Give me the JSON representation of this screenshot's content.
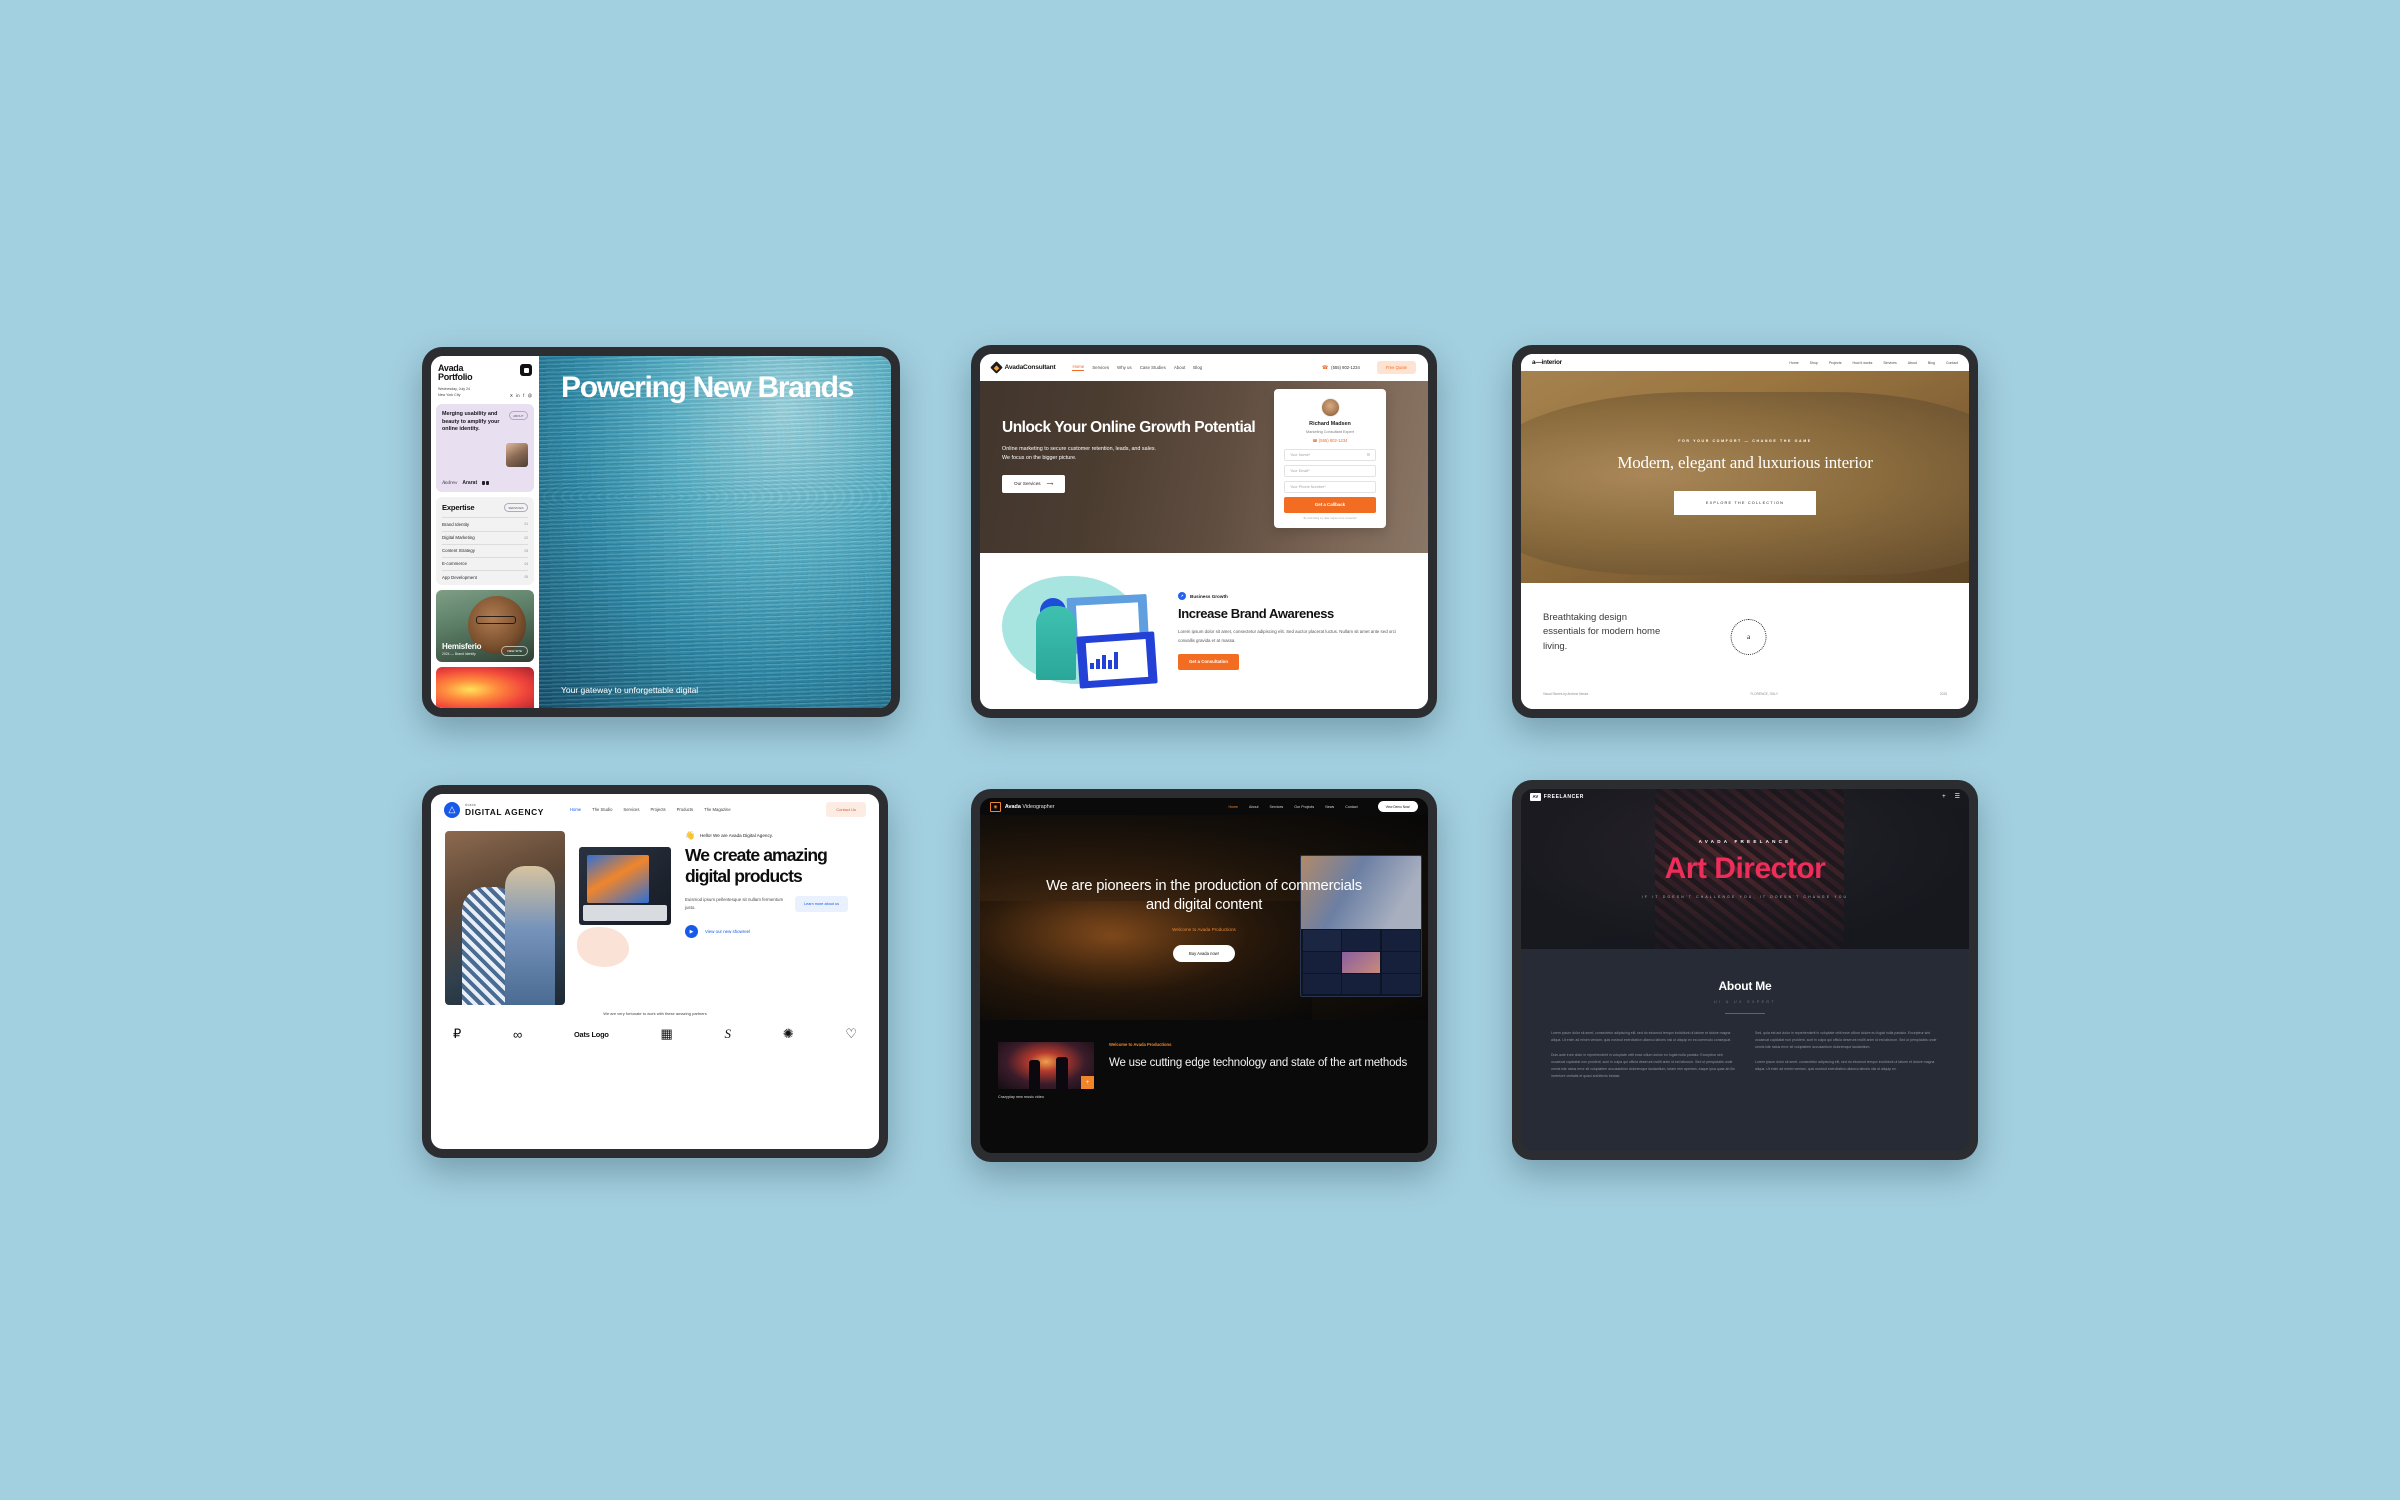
{
  "page": {
    "background_color": "#a3d0e0"
  },
  "cards": {
    "portfolio": {
      "logo_line1": "Avada",
      "logo_line2": "Portfolio",
      "date": "Wednesday, July 24",
      "location": "New York City",
      "socials": [
        "X",
        "in",
        "f",
        "@"
      ],
      "promo_text": "Merging usability and beauty to amplify your online identity.",
      "promo_pill": "ABOUT",
      "signature": "Andrew",
      "brand": "Ararat",
      "expertise_title": "Expertise",
      "expertise_pill": "SERVICES",
      "expertise": [
        {
          "label": "Brand Identity",
          "num": "01"
        },
        {
          "label": "Digital Marketing",
          "num": "02"
        },
        {
          "label": "Content Strategy",
          "num": "03"
        },
        {
          "label": "E-commerce",
          "num": "04"
        },
        {
          "label": "App Development",
          "num": "05"
        }
      ],
      "project_name": "Hemisferio",
      "project_meta": "2024 — Brand Identity",
      "project_button": "VIEW SITE",
      "hero_title": "Powering New Brands",
      "hero_sub": "Your gateway to unforgettable digital"
    },
    "consultant": {
      "logo": "AvadaConsultant",
      "menu": [
        "Home",
        "Services",
        "Why us",
        "Case Studies",
        "About",
        "Blog"
      ],
      "phone": "(555) 802-1234",
      "quote_button": "Free Quote",
      "hero_title": "Unlock Your Online Growth Potential",
      "hero_sub": "Online marketing to secure customer retention, leads, and sales. We focus on the bigger picture.",
      "hero_button": "Our Services",
      "form_name": "Richard Madsen",
      "form_role": "Marketing Consultant Expert",
      "form_phone": "(555) 802-1234",
      "field_name_placeholder": "Your Name*",
      "field_email_placeholder": "Your Email*",
      "field_phone_placeholder": "Your Phone Number*",
      "form_submit": "Get a Callback",
      "form_disclaimer": "By submitting my data I agree to be contacted",
      "section_tag": "Business Growth",
      "section_title": "Increase Brand Awareness",
      "section_body": "Lorem ipsum dolor sit amet, consectetur adipiscing elit. Sed auctor placerat luctus. Nullam sit amet ante sed orci convallis gravida et at massa.",
      "section_cta": "Get a Consultation"
    },
    "interior": {
      "logo": "a—interior",
      "menu": [
        "Home",
        "Shop",
        "Projects",
        "How it works",
        "Services",
        "About",
        "Blog",
        "Contact"
      ],
      "eyebrow": "FOR YOUR COMFORT — CHANGE THE GAME",
      "hero_title": "Modern, elegant and luxurious interior",
      "hero_button": "EXPLORE THE COLLECTION",
      "footer_heading": "Breathtaking design essentials for modern home living.",
      "stamp_letter": "a",
      "footer_left": "Visual Stories by Andrew Nestor",
      "footer_center": "FLORENCE, ITALY",
      "footer_right": "2025"
    },
    "agency": {
      "logo_small": "Avada",
      "logo_big": "DIGITAL AGENCY",
      "menu": [
        "Home",
        "The Studio",
        "Services",
        "Projects",
        "Products",
        "The Magazine"
      ],
      "contact_button": "Contact Us",
      "hello": "Hello! We are Avada Digital Agency.",
      "title": "We create amazing digital products",
      "body": "Euismod ipsum pellentesque sit nullam fermentum justo.",
      "learn_button": "Learn more about us",
      "showreel": "View our new showreel",
      "partners_text": "We are very fortunate to work with these amazing partners",
      "partner_logos": [
        "T-logo",
        "infinity-logo",
        "Oats Logo",
        "fashion-shop-logo",
        "S-logo",
        "bird-logo",
        "heart-logo"
      ]
    },
    "videographer": {
      "logo_brand": "Avada",
      "logo_word": "Videographer",
      "menu": [
        "Home",
        "About",
        "Services",
        "Our Projects",
        "News",
        "Contact"
      ],
      "demo_button": "View Demo Now!",
      "hero_title": "We are pioneers in the production of commercials and digital content",
      "hero_welcome": "Welcome to Avada Productions",
      "hero_button": "Buy Avada now!",
      "thumb_caption": "Crazyplay new music video",
      "lower_eyebrow": "Welcome to Avada Productions",
      "lower_title": "We use cutting edge technology and state of the art methods"
    },
    "freelancer": {
      "logo_mark": "AV",
      "logo_text": "FREELANCER",
      "eyebrow": "AVADA FREELANCE",
      "title": "Art Director",
      "quote": "IF IT DOESN'T CHALLENGE YOU, IT DOESN'T CHANGE YOU",
      "accent_color": "#ef2d5b",
      "about_title": "About Me",
      "about_sub": "UI & UX EXPERT",
      "about_col1_p1": "Lorem ipsum dolor sit amet, consectetur adipiscing elit, sed do eiusmod tempor incididunt ut labore et dolore magna aliqua. Ut enim ad minim veniam, quis nostrud exercitation ullamco laboris nisi ut aliquip ex ea commodo consequat.",
      "about_col1_p2": "Duis aute irure dolor in reprehenderit in voluptate velit esse cillum dolore eu fugiat nulla pariatur. Excepteur sint occaecat cupidatat non proident, sunt in culpa qui officia deserunt mollit anim id est laborum. Sed ut perspiciatis unde omnis iste natus error sit voluptatem accusantium doloremque laudantium, totam rem aperiam, eaque ipsa quae ab illo inventore veritatis et quasi architecto beatae.",
      "about_col2_p1": "Sed, quia est aut dolor in reprehenderit in voluptate velit esse cillum dolore eu fugiat nulla pariatur. Excepteur sint occaecat cupidatat non proident, sunt in culpa qui officia deserunt mollit anim id est laborum. Sed ut perspiciatis unde omnis iste natus error sit voluptatem accusantium doloremque laudantium.",
      "about_col2_p2": "Lorem ipsum dolor sit amet, consectetur adipiscing elit, sed do eiusmod tempor incididunt ut labore et dolore magna aliqua. Ut enim ad minim veniam, quis nostrud exercitation ullamco laboris nisi ut aliquip ex."
    }
  }
}
